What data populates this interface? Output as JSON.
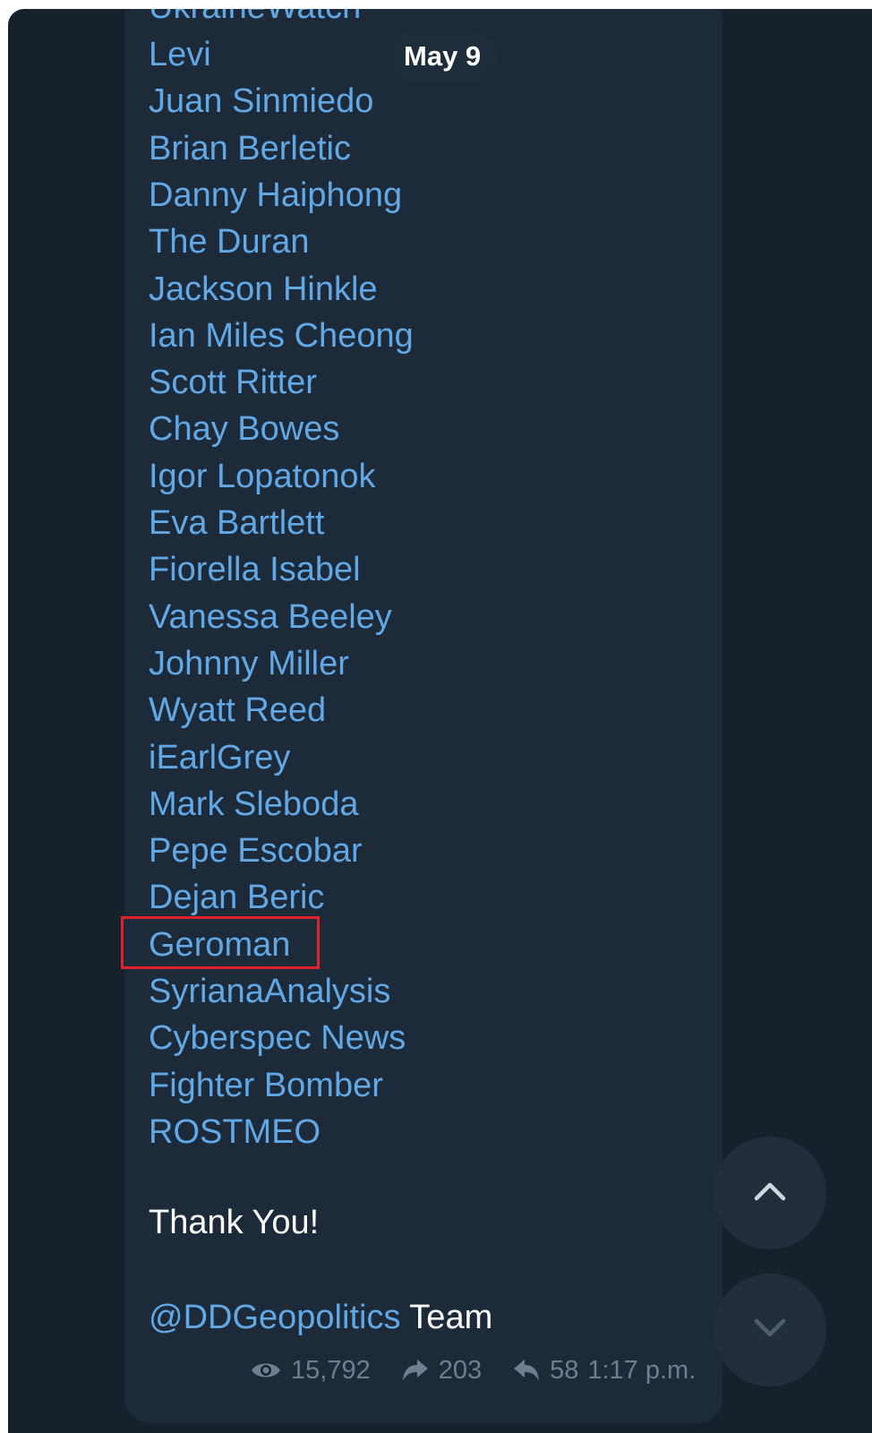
{
  "date_badge": "May 9",
  "cut_off_line": "UkraineWatch",
  "links": [
    "Levi",
    "Juan Sinmiedo",
    "Brian Berletic",
    "Danny Haiphong",
    "The Duran",
    "Jackson Hinkle",
    "Ian Miles Cheong",
    "Scott Ritter",
    "Chay Bowes",
    "Igor Lopatonok",
    "Eva Bartlett",
    "Fiorella Isabel",
    "Vanessa Beeley",
    "Johnny Miller",
    "Wyatt Reed",
    "iEarlGrey",
    "Mark Sleboda",
    "Pepe Escobar",
    "Dejan Beric",
    "Geroman",
    "SyrianaAnalysis",
    "Cyberspec News",
    "Fighter Bomber",
    "ROSTMEO"
  ],
  "highlighted_link": "Geroman",
  "highlight_color": "#e0222c",
  "thanks_text": "Thank You!",
  "signoff": {
    "mention": "@DDGeopolitics",
    "rest": " Team"
  },
  "meta": {
    "views": "15,792",
    "shares": "203",
    "replies": "58",
    "time": "1:17 p.m."
  },
  "icons": {
    "views": "eye-icon",
    "shares": "share-arrow-icon",
    "replies": "reply-arrow-icon",
    "scroll_up": "chevron-up-icon",
    "scroll_down": "chevron-down-icon"
  },
  "colors": {
    "background": "#17212b",
    "bubble": "#1c2a39",
    "link": "#62a8e5",
    "text": "#ffffff",
    "meta": "#6d7f90"
  }
}
